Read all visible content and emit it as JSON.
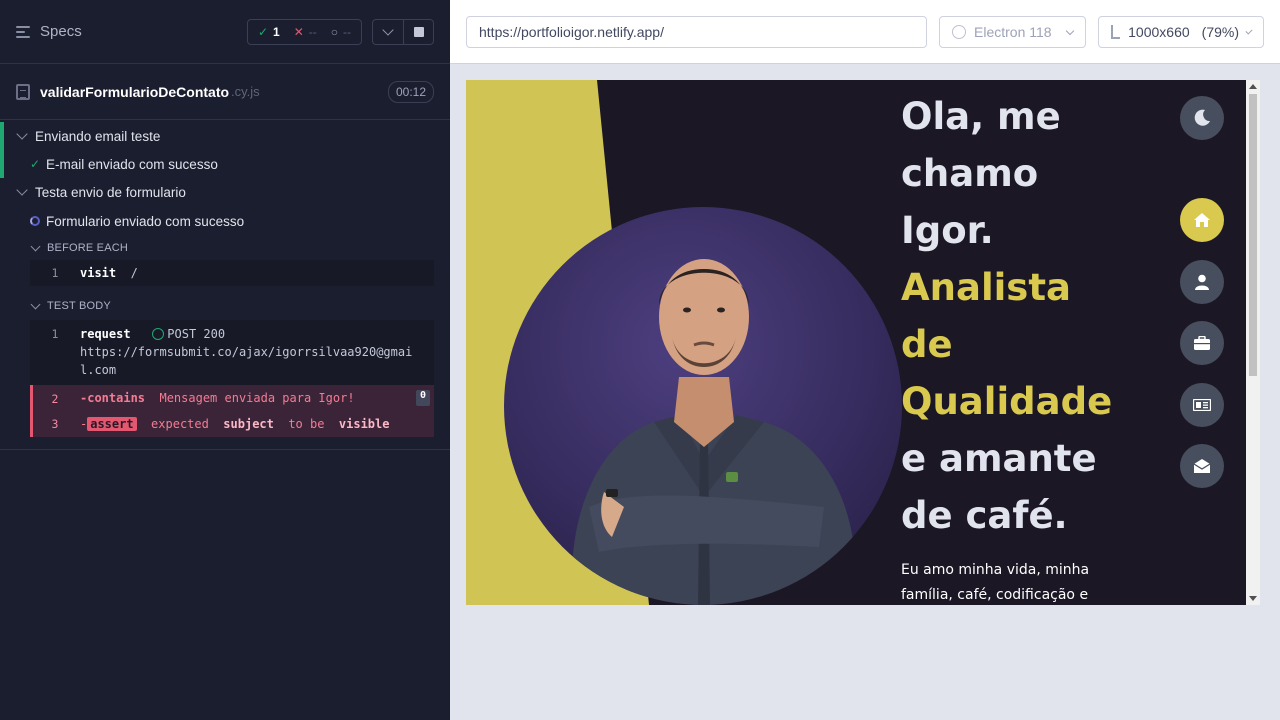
{
  "reporter": {
    "specs_label": "Specs",
    "stats": {
      "passed": "1",
      "failed": "--",
      "pending": "--"
    },
    "spec": {
      "name": "validarFormularioDeContato",
      "ext": ".cy.js",
      "duration": "00:12"
    },
    "suites": [
      {
        "title": "Enviando email teste",
        "tests": [
          {
            "title": "E-mail enviado com sucesso",
            "state": "passed"
          }
        ]
      },
      {
        "title": "Testa envio de formulario",
        "tests": [
          {
            "title": "Formulario enviado com sucesso",
            "state": "running"
          }
        ]
      }
    ],
    "before_each": {
      "title": "BEFORE EACH",
      "commands": [
        {
          "num": "1",
          "name": "visit",
          "arg": "/"
        }
      ]
    },
    "test_body": {
      "title": "TEST BODY",
      "commands": [
        {
          "num": "1",
          "name": "request",
          "status": "POST 200",
          "url": "https://formsubmit.co/ajax/igorrsilvaa920@gmail.com"
        },
        {
          "num": "2",
          "name": "-contains",
          "arg": "Mensagem enviada para Igor!",
          "badge": "0"
        },
        {
          "num": "3",
          "prefix": "-",
          "tag": "assert",
          "parts": [
            "expected",
            "subject",
            "to be",
            "visible"
          ]
        }
      ]
    }
  },
  "aut": {
    "url": "https://portfolioigor.netlify.app/",
    "browser": "Electron 118",
    "viewport": "1000x660",
    "zoom": "(79%)",
    "site": {
      "hero_lines": [
        {
          "text": "Ola, me",
          "highlight": false
        },
        {
          "text": "chamo",
          "highlight": false
        },
        {
          "text": "Igor.",
          "highlight": false
        },
        {
          "text": "Analista",
          "highlight": true
        },
        {
          "text": "de",
          "highlight": true
        },
        {
          "text": "Qualidade",
          "highlight": true
        },
        {
          "text": "e amante",
          "highlight": false
        },
        {
          "text": "de café.",
          "highlight": false
        }
      ],
      "sub_line1": "Eu amo minha vida, minha",
      "sub_line2": "família, café, codificação e",
      "nav_icons": [
        "moon-icon",
        "home-icon",
        "user-icon",
        "briefcase-icon",
        "newspaper-icon",
        "envelope-open-icon"
      ],
      "colors": {
        "accent": "#d9c94e",
        "background": "#1b1725",
        "nav_button": "#474e5e",
        "circle": "#362c5e"
      }
    }
  }
}
